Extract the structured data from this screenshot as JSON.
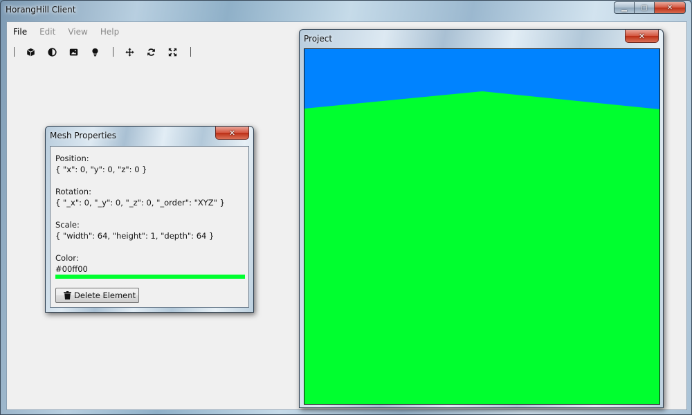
{
  "window": {
    "title": "HorangHill Client",
    "caption": {
      "minimize": "▁",
      "maximize": "▢",
      "close": "✕"
    }
  },
  "menubar": {
    "items": [
      {
        "label": "File",
        "enabled": true
      },
      {
        "label": "Edit",
        "enabled": false
      },
      {
        "label": "View",
        "enabled": false
      },
      {
        "label": "Help",
        "enabled": false
      }
    ]
  },
  "toolbar": {
    "groups": [
      [
        "cube-icon",
        "half-circle-icon",
        "image-icon",
        "lightbulb-icon"
      ],
      [
        "move-icon",
        "rotate-icon",
        "expand-icon"
      ]
    ]
  },
  "mesh_properties": {
    "title": "Mesh Properties",
    "close_label": "✕",
    "position_label": "Position:",
    "position_value": "{ \"x\": 0, \"y\": 0, \"z\": 0 }",
    "rotation_label": "Rotation:",
    "rotation_value": "{ \"_x\": 0, \"_y\": 0, \"_z\": 0, \"_order\": \"XYZ\" }",
    "scale_label": "Scale:",
    "scale_value": "{ \"width\": 64, \"height\": 1, \"depth\": 64 }",
    "color_label": "Color:",
    "color_value": "#00ff00",
    "color_swatch": "#00ff2f",
    "delete_label": "Delete Element"
  },
  "project": {
    "title": "Project",
    "close_label": "✕",
    "sky_color": "#0083ff",
    "ground_color": "#00ff2f"
  }
}
